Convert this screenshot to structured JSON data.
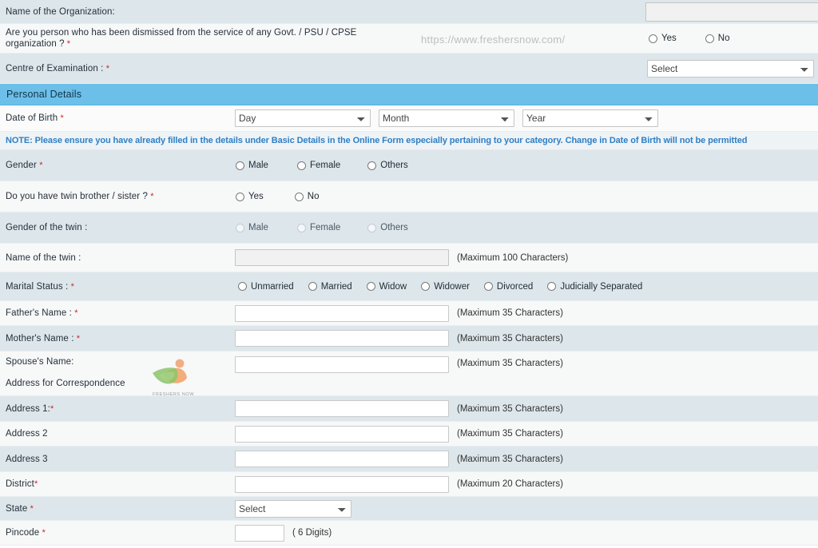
{
  "watermarks": {
    "url": "https://www.freshersnow.com/",
    "logo_caption": "FRESHERS NOW"
  },
  "top_rows": [
    {
      "label": "Name of the Organization:",
      "required": false,
      "control": "textbox-disabled"
    },
    {
      "label": "Are you person who has been dismissed from the service of any Govt. / PSU / CPSE organization ?",
      "required": true,
      "control": "radio",
      "options": [
        "Yes",
        "No"
      ]
    },
    {
      "label": "Centre of Examination : ",
      "required": true,
      "control": "select",
      "selected": "Select"
    }
  ],
  "section": {
    "title": "Personal Details"
  },
  "dob": {
    "label": "Date of Birth ",
    "required": true,
    "day": "Day",
    "month": "Month",
    "year": "Year"
  },
  "note": "NOTE: Please ensure you have already filled in the details under Basic Details in the Online Form especially pertaining to your category. Change in Date of Birth will not be permitted",
  "gender": {
    "label": "Gender ",
    "required": true,
    "options": [
      "Male",
      "Female",
      "Others"
    ]
  },
  "twin": {
    "label": "Do you have twin brother / sister ? ",
    "required": true,
    "options": [
      "Yes",
      "No"
    ]
  },
  "twin_gender": {
    "label": "Gender of the twin : ",
    "required": false,
    "options": [
      "Male",
      "Female",
      "Others"
    ]
  },
  "twin_name": {
    "label": "Name of the twin : ",
    "required": false,
    "hint": "(Maximum 100 Characters)",
    "value": ""
  },
  "marital": {
    "label": "Marital Status : ",
    "required": true,
    "options": [
      "Unmarried",
      "Married",
      "Widow",
      "Widower",
      "Divorced",
      "Judicially Separated"
    ]
  },
  "names": [
    {
      "label": "Father's Name : ",
      "required": true,
      "hint": "(Maximum 35 Characters)",
      "value": ""
    },
    {
      "label": "Mother's Name : ",
      "required": true,
      "hint": "(Maximum 35 Characters)",
      "value": ""
    },
    {
      "label": "Spouse's Name:",
      "required": false,
      "hint": "(Maximum 35 Characters)",
      "value": ""
    }
  ],
  "address_heading": "Address for Correspondence",
  "address": [
    {
      "label": "Address 1:",
      "required": true,
      "hint": "(Maximum 35 Characters)",
      "value": ""
    },
    {
      "label": "Address 2",
      "required": false,
      "hint": "(Maximum 35 Characters)",
      "value": ""
    },
    {
      "label": "Address 3",
      "required": false,
      "hint": "(Maximum 35 Characters)",
      "value": ""
    },
    {
      "label": "District",
      "required": true,
      "hint": "(Maximum 20 Characters)",
      "value": ""
    }
  ],
  "state": {
    "label": "State ",
    "required": true,
    "selected": "Select"
  },
  "pincode": {
    "label": "Pincode ",
    "required": true,
    "hint": "( 6 Digits)",
    "value": ""
  },
  "colors": {
    "section_header": "#6cbfe8",
    "note_text": "#2f7fc4",
    "required_star": "#d2232a",
    "row_tint": "#dde6eb",
    "row_plain": "#f7f8f8"
  }
}
